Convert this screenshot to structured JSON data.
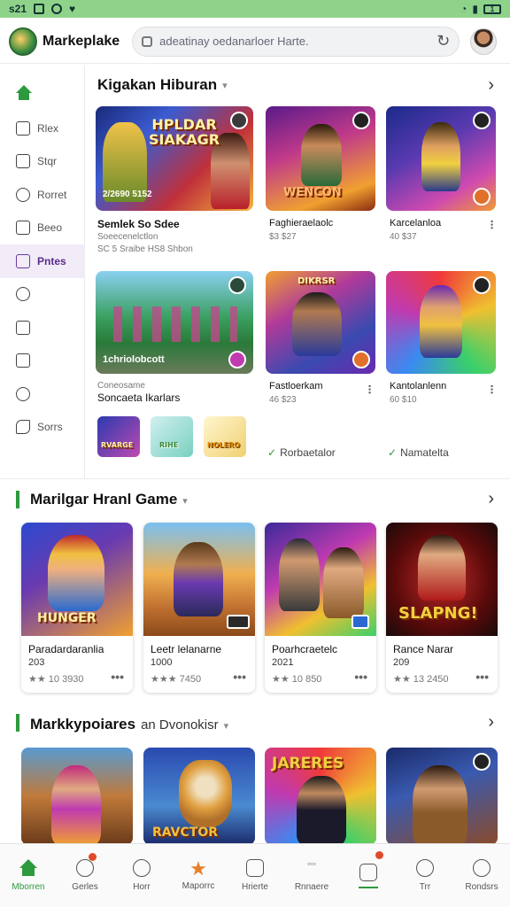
{
  "statusbar": {
    "time": "s21",
    "battery": "1"
  },
  "header": {
    "app_title": "Markeplake",
    "search_placeholder": "adeatinay oedanarloer Harte."
  },
  "sidebar": {
    "items": [
      {
        "label": ""
      },
      {
        "label": "Rlex"
      },
      {
        "label": "Stqr"
      },
      {
        "label": "Rorret"
      },
      {
        "label": "Beeo"
      },
      {
        "label": "Pntes"
      },
      {
        "label": ""
      },
      {
        "label": ""
      },
      {
        "label": ""
      },
      {
        "label": ""
      },
      {
        "label": "Sorrs"
      }
    ]
  },
  "section1": {
    "title": "Kigakan Hiburan",
    "tiles": [
      {
        "art": "HPLDAR SIAKAGR",
        "caption": "2/2690 5152",
        "title": "Semlek So Sdee",
        "sub1": "Soeecenelctlon",
        "sub2": "SC 5 Sraibe HS8 Shbon"
      },
      {
        "art": "WENCON",
        "title": "Faghieraelaolc",
        "sub1": "$3 $27"
      },
      {
        "art": "",
        "title": "Karcelanloa",
        "sub1": "40 $37"
      },
      {
        "art": "",
        "caption": "1chriolobcott",
        "title": "Soncaeta Ikarlars",
        "sub1": "Coneosame"
      },
      {
        "art": "DIKRSR",
        "title": "Fastloerkam",
        "sub1": "46 $23"
      },
      {
        "art": "",
        "title": "Kantolanlenn",
        "sub1": "60 $10"
      }
    ],
    "small_thumbs": [
      {
        "art": "RVARGE"
      },
      {
        "art": "RIHE"
      },
      {
        "art": "NOLERO"
      }
    ],
    "links": [
      "Rorbaetalor",
      "Namatelta"
    ]
  },
  "section2": {
    "title": "Marilgar Hranl Game",
    "cards": [
      {
        "art": "HUNGER",
        "title": "Paradardaranlia",
        "year": "203",
        "rating": "★★ 10 3930"
      },
      {
        "art": "",
        "title": "Leetr lelanarne",
        "year": "1000",
        "rating": "★★★ 7450"
      },
      {
        "art": "",
        "title": "Poarhcraetelc",
        "year": "2021",
        "rating": "★★ 10 850"
      },
      {
        "art": "SLAPNG!",
        "title": "Rance Narar",
        "year": "209",
        "rating": "★★ 13 2450"
      }
    ]
  },
  "section3": {
    "title": "Markkypoiares",
    "extra": "an Dvonokisr",
    "cards": [
      {
        "art": ""
      },
      {
        "art": "RAVCTOR"
      },
      {
        "art": "JARERES"
      },
      {
        "art": ""
      }
    ]
  },
  "bottom_nav": [
    {
      "label": "Mborren"
    },
    {
      "label": "Gerles"
    },
    {
      "label": "Horr"
    },
    {
      "label": "Maporrc"
    },
    {
      "label": "Hrierte"
    },
    {
      "label": "Rnnaere"
    },
    {
      "label": ""
    },
    {
      "label": "Trr"
    },
    {
      "label": "Rondsrs"
    }
  ],
  "colors": {
    "accent": "#2e9a3e",
    "status_bar": "#8fd38a",
    "active_sidebar": "#6a3aa0",
    "notification": "#e04a2a"
  }
}
